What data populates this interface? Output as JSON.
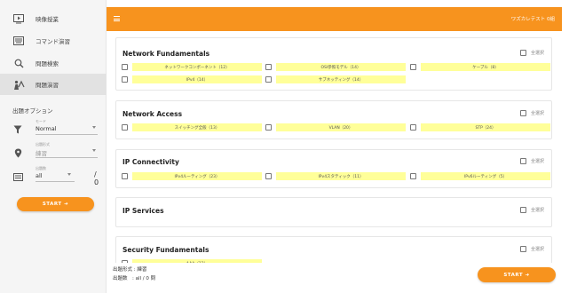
{
  "sidebar": {
    "items": [
      {
        "label": "映像授業",
        "icon": "video-lesson-icon"
      },
      {
        "label": "コマンド演習",
        "icon": "keyboard-icon"
      },
      {
        "label": "問題検索",
        "icon": "search-icon"
      },
      {
        "label": "問題演習",
        "icon": "practice-icon"
      }
    ],
    "active_index": 3,
    "options_title": "出題オプション",
    "mode": {
      "caption": "モード",
      "value": "Normal"
    },
    "format": {
      "caption": "出題形式",
      "value": "練習"
    },
    "count": {
      "caption": "出題数",
      "value": "all",
      "suffix": "/ 0"
    },
    "start_label": "START ➜"
  },
  "header": {
    "user_name": "ワズカレテスト 0組",
    "accent_color": "#f7931e"
  },
  "sections": [
    {
      "title": "Network Fundamentals",
      "select_all": "全選択",
      "items": [
        "ネットワークコンポーネント（12）",
        "OSI参照モデル（14）",
        "ケーブル（8）",
        "IPv4（14）",
        "サブネッティング（14）"
      ]
    },
    {
      "title": "Network Access",
      "select_all": "全選択",
      "items": [
        "スイッチング全般（13）",
        "VLAN（20）",
        "STP（24）"
      ]
    },
    {
      "title": "IP Connectivity",
      "select_all": "全選択",
      "items": [
        "IPv4ルーティング（23）",
        "IPv4スタティック（11）",
        "IPv6ルーティング（5）"
      ]
    },
    {
      "title": "IP Services",
      "select_all": "全選択",
      "items": []
    },
    {
      "title": "Security Fundamentals",
      "select_all": "全選択",
      "items": [
        "AAA（12）"
      ]
    }
  ],
  "footer": {
    "format_line": "出題形式 : 練習",
    "count_line": "出題数　: all / 0 問",
    "start_label": "START ➜"
  }
}
